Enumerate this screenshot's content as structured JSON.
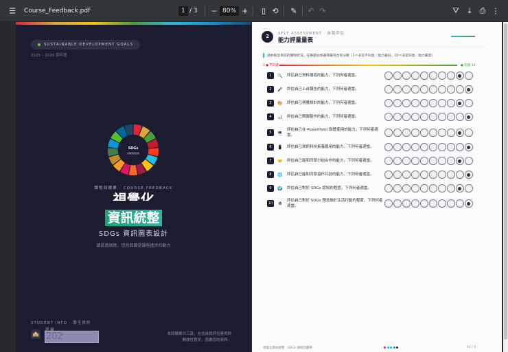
{
  "toolbar": {
    "menu_icon": "menu-icon",
    "filename": "Course_Feedback.pdf",
    "page_current": "1",
    "page_total": "/ 3",
    "zoom": "80%",
    "minus": "−",
    "plus": "+"
  },
  "cover": {
    "pill": "SUSTAINABLE DEVELOPMENT GOALS",
    "year": "2025 – 2026 學年度",
    "donut_title": "SDGs",
    "donut_sub": "永續發展目標",
    "eyebrow": "課程回饋單 · COURSE FEEDBACK",
    "title1": "視覺化",
    "title2": "資訊統整",
    "subtitle": "SDGs 資訊圖表設計",
    "tagline": "請認真填寫，您的回饋是課程進步的動力",
    "student_label": "STUDENT INFO · 學生資訊",
    "class_label": "班 級",
    "class_value": "202",
    "note1": "本回饋單共三頁，包含自我評估量表與",
    "note2": "開放性意見，感謝您的參與。",
    "donut_colors": [
      "#e5243b",
      "#dda63a",
      "#4c9f38",
      "#c5192d",
      "#ff3a21",
      "#26bde2",
      "#fcc30b",
      "#a21942",
      "#fd6925",
      "#dd1367",
      "#fd9d24",
      "#bf8b2e",
      "#3f7e44",
      "#0a97d9",
      "#56c02b",
      "#00689d",
      "#19486a"
    ]
  },
  "assessment": {
    "step": "2",
    "eyebrow": "SELF ASSESSMENT · 自我評估",
    "title": "能力評量量表",
    "instruction": "請依照您目前的實際狀況，在每題右側選擇最符合的分數（1＝非常不同意／能力最低，10＝非常同意／能力最高）",
    "scale_low": "1 ● 不同意",
    "scale_high": "● 同意 10",
    "items": [
      {
        "n": "1",
        "icon": "🔍",
        "text": "評估自己資料搜尋的能力，下列何者適當。",
        "score": 9
      },
      {
        "n": "2",
        "icon": "🎤",
        "text": "評估自己上台報告的能力，下列何者適當。",
        "score": 10
      },
      {
        "n": "3",
        "icon": "🎨",
        "text": "評估自己視覺設計的能力，下列何者適當。",
        "score": 9
      },
      {
        "n": "4",
        "icon": "📊",
        "text": "評估自己簡報製作的能力，下列何者適當。",
        "score": 10
      },
      {
        "n": "5",
        "icon": "💻",
        "text": "評估自己在 PowerPoint 軟體使用的能力，下列何者適當。",
        "score": 9
      },
      {
        "n": "6",
        "icon": "📱",
        "text": "評估自己資訊科技素養應用的能力，下列何者適當。",
        "score": 10
      },
      {
        "n": "7",
        "icon": "🤝",
        "text": "評估自己能和同學分組合作的能力，下列何者適當。",
        "score": 9
      },
      {
        "n": "8",
        "icon": "🌐",
        "text": "評估自己能和同學協作共創的能力，下列何者適當。",
        "score": 10
      },
      {
        "n": "9",
        "icon": "🌍",
        "text": "評估自己對於 SDGs 認知的程度，下列何者適當。",
        "score": 9
      },
      {
        "n": "10",
        "icon": "♻",
        "text": "評估自己對於 SDGs 理念融於生活行動的程度，下列何者適當。",
        "score": 10
      }
    ],
    "footer_left": "視覺化資訊統整 · SDGs 課程回饋單",
    "footer_right": "P.2 / 3"
  }
}
